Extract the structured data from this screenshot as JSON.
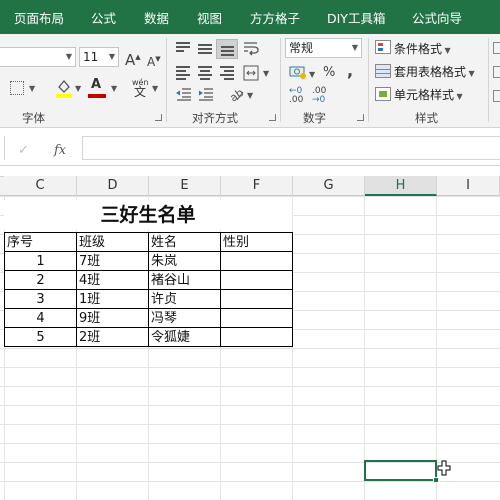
{
  "ribbon_tabs": [
    "页面布局",
    "公式",
    "数据",
    "视图",
    "方方格子",
    "DIY工具箱",
    "公式向导"
  ],
  "font_group": {
    "label": "字体",
    "font_size": "11",
    "grow_glyph": "A",
    "shrink_glyph": "A",
    "font_color_glyph": "A",
    "phonetic_glyph": "wén"
  },
  "alignment_group": {
    "label": "对齐方式"
  },
  "number_group": {
    "label": "数字",
    "format_value": "常规",
    "percent_glyph": "%",
    "comma_glyph": ","
  },
  "styles_group": {
    "label": "样式",
    "conditional_format": "条件格式",
    "format_as_table": "套用表格格式",
    "cell_styles": "单元格样式"
  },
  "formula_bar": {
    "fx": "fx",
    "cancel": "✓",
    "value": ""
  },
  "columns": [
    "C",
    "D",
    "E",
    "F",
    "G",
    "H",
    "I"
  ],
  "selected_column": "H",
  "sheet": {
    "title": "三好生名单",
    "headers": [
      "序号",
      "班级",
      "姓名",
      "性别"
    ],
    "rows": [
      [
        "1",
        "7班",
        "朱岚",
        ""
      ],
      [
        "2",
        "4班",
        "褚谷山",
        ""
      ],
      [
        "3",
        "1班",
        "许贞",
        ""
      ],
      [
        "4",
        "9班",
        "冯琴",
        ""
      ],
      [
        "5",
        "2班",
        "令狐婕",
        ""
      ]
    ]
  },
  "colors": {
    "accent": "#217346",
    "font_color": "#c00000",
    "highlight": "#ffff00"
  }
}
